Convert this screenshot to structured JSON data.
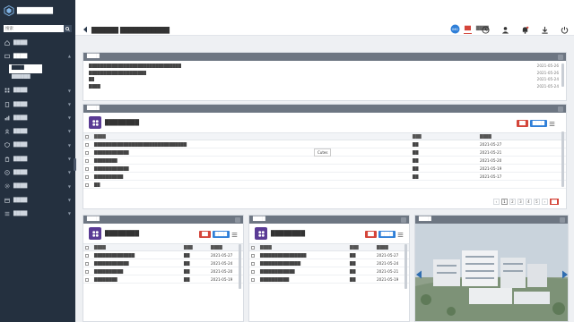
{
  "sidebar": {
    "title": "████████",
    "search_placeholder": "搜索",
    "items": [
      {
        "label": "████",
        "open": false
      },
      {
        "label": "████",
        "open": true
      },
      {
        "label": "████",
        "open": false
      },
      {
        "label": "████",
        "open": false
      },
      {
        "label": "████",
        "open": false
      },
      {
        "label": "████",
        "open": false
      },
      {
        "label": "████",
        "open": false
      },
      {
        "label": "████",
        "open": false
      },
      {
        "label": "████",
        "open": false
      },
      {
        "label": "████",
        "open": false
      },
      {
        "label": "████",
        "open": false
      },
      {
        "label": "████",
        "open": false
      }
    ],
    "subitems": [
      {
        "label": "████",
        "active": true
      },
      {
        "label": "██████",
        "active": false
      }
    ]
  },
  "header": {
    "title": "██████ ███████████",
    "tabs": [
      {
        "label": "██",
        "active": true
      },
      {
        "label": "████",
        "active": false
      }
    ]
  },
  "notice_panel": {
    "title": "████",
    "rows": [
      {
        "text": "████████████████████████████████",
        "date": "2021-05-26"
      },
      {
        "text": "████████████████████",
        "date": "2021-05-26"
      },
      {
        "text": "██",
        "date": "2021-05-24"
      },
      {
        "text": "████",
        "date": "2021-05-24"
      }
    ]
  },
  "task_panel": {
    "title": "████",
    "card_title": "████████",
    "btn_add": "██",
    "btn_more": "████",
    "columns": [
      "████",
      "███",
      "████"
    ],
    "rows": [
      {
        "name": "████████████████████████████████",
        "person": "██",
        "date": "2021-05-27"
      },
      {
        "name": "████████████",
        "person": "██",
        "date": "2021-05-21"
      },
      {
        "name": "████████",
        "person": "██",
        "date": "2021-05-20"
      },
      {
        "name": "████████████",
        "person": "██",
        "date": "2021-05-19"
      },
      {
        "name": "██████████",
        "person": "██",
        "date": "2021-05-17"
      }
    ],
    "footer_label": "██",
    "pager": [
      "1",
      "2",
      "3",
      "4",
      "5"
    ],
    "pager_go": "██"
  },
  "tooltip": "Cutes",
  "left_card": {
    "panel_title": "████",
    "card_title": "████████",
    "btn_add": "██",
    "btn_more": "████",
    "columns": [
      "████",
      "███",
      "████"
    ],
    "rows": [
      {
        "name": "██████████████",
        "person": "██",
        "date": "2021-05-27"
      },
      {
        "name": "████████████",
        "person": "██",
        "date": "2021-05-24"
      },
      {
        "name": "██████████",
        "person": "██",
        "date": "2021-05-20"
      },
      {
        "name": "████████",
        "person": "██",
        "date": "2021-05-19"
      }
    ]
  },
  "mid_card": {
    "panel_title": "████",
    "card_title": "████████",
    "btn_add": "██",
    "btn_more": "████",
    "columns": [
      "████",
      "███",
      "████"
    ],
    "rows": [
      {
        "name": "████████████████",
        "person": "██",
        "date": "2021-05-27"
      },
      {
        "name": "██████████████",
        "person": "██",
        "date": "2021-05-24"
      },
      {
        "name": "████████████",
        "person": "██",
        "date": "2021-05-21"
      },
      {
        "name": "██████████",
        "person": "██",
        "date": "2021-05-19"
      }
    ]
  },
  "image_panel": {
    "title": "████"
  },
  "colors": {
    "sidebar_bg": "#24303f",
    "accent_red": "#d4453a",
    "accent_blue": "#2f7fd8",
    "card_icon": "#5a3b95",
    "panel_head": "#6d7682"
  }
}
